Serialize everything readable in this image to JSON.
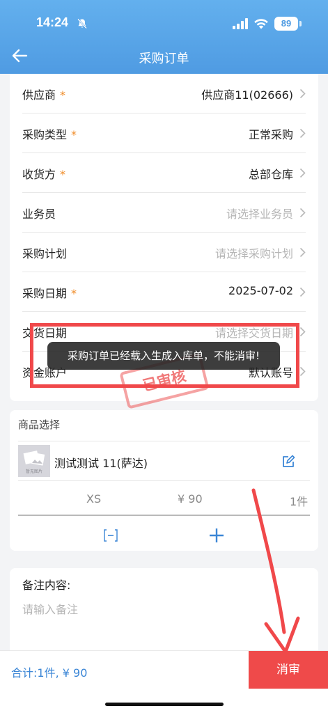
{
  "status_bar": {
    "time": "14:24",
    "battery": "89"
  },
  "header": {
    "title": "采购订单"
  },
  "form": {
    "supplier": {
      "label": "供应商",
      "required": "*",
      "value": "供应商11(02666)"
    },
    "purchase_type": {
      "label": "采购类型",
      "required": "*",
      "value": "正常采购"
    },
    "receiver": {
      "label": "收货方",
      "required": "*",
      "value": "总部仓库"
    },
    "salesman": {
      "label": "业务员",
      "placeholder": "请选择业务员"
    },
    "plan": {
      "label": "采购计划",
      "placeholder": "请选择采购计划"
    },
    "date": {
      "label": "采购日期",
      "required": "*",
      "value": "2025-07-02"
    },
    "delivery": {
      "label": "交货日期",
      "placeholder": "请选择交货日期"
    },
    "account": {
      "label": "资金账户",
      "value": "默认账号"
    }
  },
  "stamp": {
    "text": "已审核"
  },
  "toast": {
    "message": "采购订单已经载入生成入库单，不能消审!"
  },
  "goods": {
    "header": "商品选择",
    "thumb_caption": "暂无图片",
    "name": "测试测试 11(萨达)",
    "sku": {
      "size": "XS",
      "price": "¥ 90",
      "qty": "1件"
    }
  },
  "remark": {
    "label": "备注内容:",
    "placeholder": "请输入备注"
  },
  "footer": {
    "total": "合计:1件, ¥ 90",
    "cancel_button": "消审"
  },
  "colors": {
    "header": "#4f9be2",
    "accent_blue": "#3b86d6",
    "danger": "#ef4a4a",
    "required": "#f08a24"
  }
}
